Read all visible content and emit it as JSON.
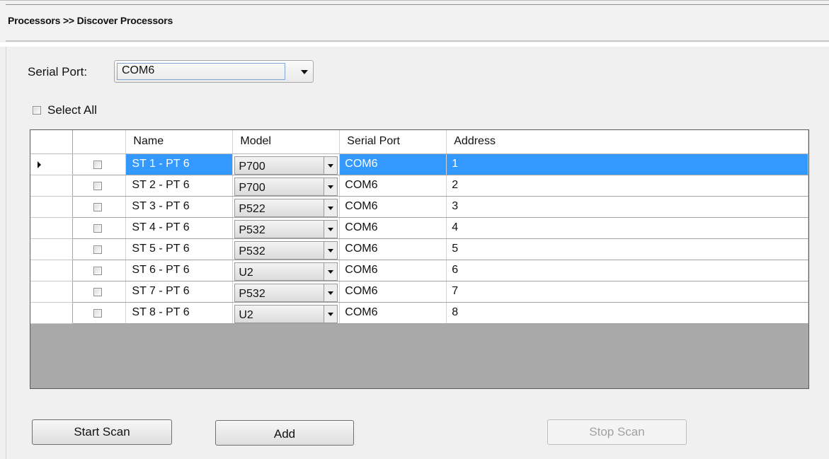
{
  "breadcrumb": "Processors >> Discover Processors",
  "serial_port": {
    "label": "Serial Port:",
    "value": "COM6"
  },
  "select_all": {
    "label": "Select All",
    "checked": false
  },
  "grid": {
    "columns": [
      "",
      "Name",
      "Model",
      "Serial Port",
      "Address"
    ],
    "rows": [
      {
        "name": "ST 1 - PT 6",
        "model": "P700",
        "serial_port": "COM6",
        "address": "1",
        "selected": true
      },
      {
        "name": "ST 2 - PT 6",
        "model": "P700",
        "serial_port": "COM6",
        "address": "2",
        "selected": false
      },
      {
        "name": "ST 3 - PT 6",
        "model": "P522",
        "serial_port": "COM6",
        "address": "3",
        "selected": false
      },
      {
        "name": "ST 4 - PT 6",
        "model": "P532",
        "serial_port": "COM6",
        "address": "4",
        "selected": false
      },
      {
        "name": "ST 5 - PT 6",
        "model": "P532",
        "serial_port": "COM6",
        "address": "5",
        "selected": false
      },
      {
        "name": "ST 6 - PT 6",
        "model": "U2",
        "serial_port": "COM6",
        "address": "6",
        "selected": false
      },
      {
        "name": "ST 7 - PT 6",
        "model": "P532",
        "serial_port": "COM6",
        "address": "7",
        "selected": false
      },
      {
        "name": "ST 8 - PT 6",
        "model": "U2",
        "serial_port": "COM6",
        "address": "8",
        "selected": false
      }
    ]
  },
  "buttons": {
    "start_scan": "Start Scan",
    "add": "Add",
    "stop_scan": "Stop Scan"
  },
  "colors": {
    "selection": "#3399ff",
    "grid_empty": "#a9a9a9"
  }
}
